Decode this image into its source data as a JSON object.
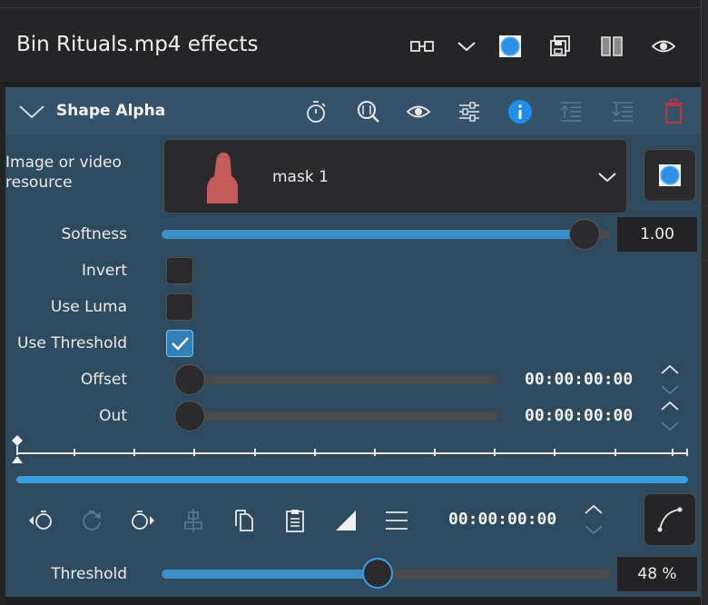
{
  "header": {
    "title": "Bin Rituals.mp4 effects"
  },
  "effect": {
    "name": "Shape Alpha",
    "resource": {
      "label": "Image or video resource",
      "selected": "mask 1"
    },
    "softness": {
      "label": "Softness",
      "value": "1.00",
      "fraction": 1.0
    },
    "invert": {
      "label": "Invert",
      "checked": false
    },
    "use_luma": {
      "label": "Use Luma",
      "checked": false
    },
    "use_threshold": {
      "label": "Use Threshold",
      "checked": true
    },
    "offset": {
      "label": "Offset",
      "timecode": "00:00:00:00",
      "fraction": 0.0
    },
    "out": {
      "label": "Out",
      "timecode": "00:00:00:00",
      "fraction": 0.0
    },
    "keyframe_timecode": "00:00:00:00",
    "threshold": {
      "label": "Threshold",
      "value": "48 %",
      "percent": 48
    }
  },
  "icons": {
    "header": [
      "compare-icon",
      "chevron-down-icon",
      "color-swatch-icon",
      "save-icon",
      "split-view-icon",
      "eye-icon"
    ],
    "effect_toolbar": [
      "timer-icon",
      "zoom-icon",
      "eye-icon",
      "sliders-icon",
      "info-icon",
      "move-up-icon",
      "move-down-icon",
      "delete-icon"
    ],
    "keyframe_toolbar": [
      "previous-keyframe-icon",
      "add-keyframe-icon",
      "next-keyframe-icon",
      "align-icon",
      "copy-icon",
      "paste-icon",
      "interpolation-icon",
      "menu-icon"
    ]
  },
  "colors": {
    "panel": "#2d4a5e",
    "accent": "#3a9fe0",
    "delete": "#c0353d",
    "mask_thumbnail": "#c45a5a"
  }
}
